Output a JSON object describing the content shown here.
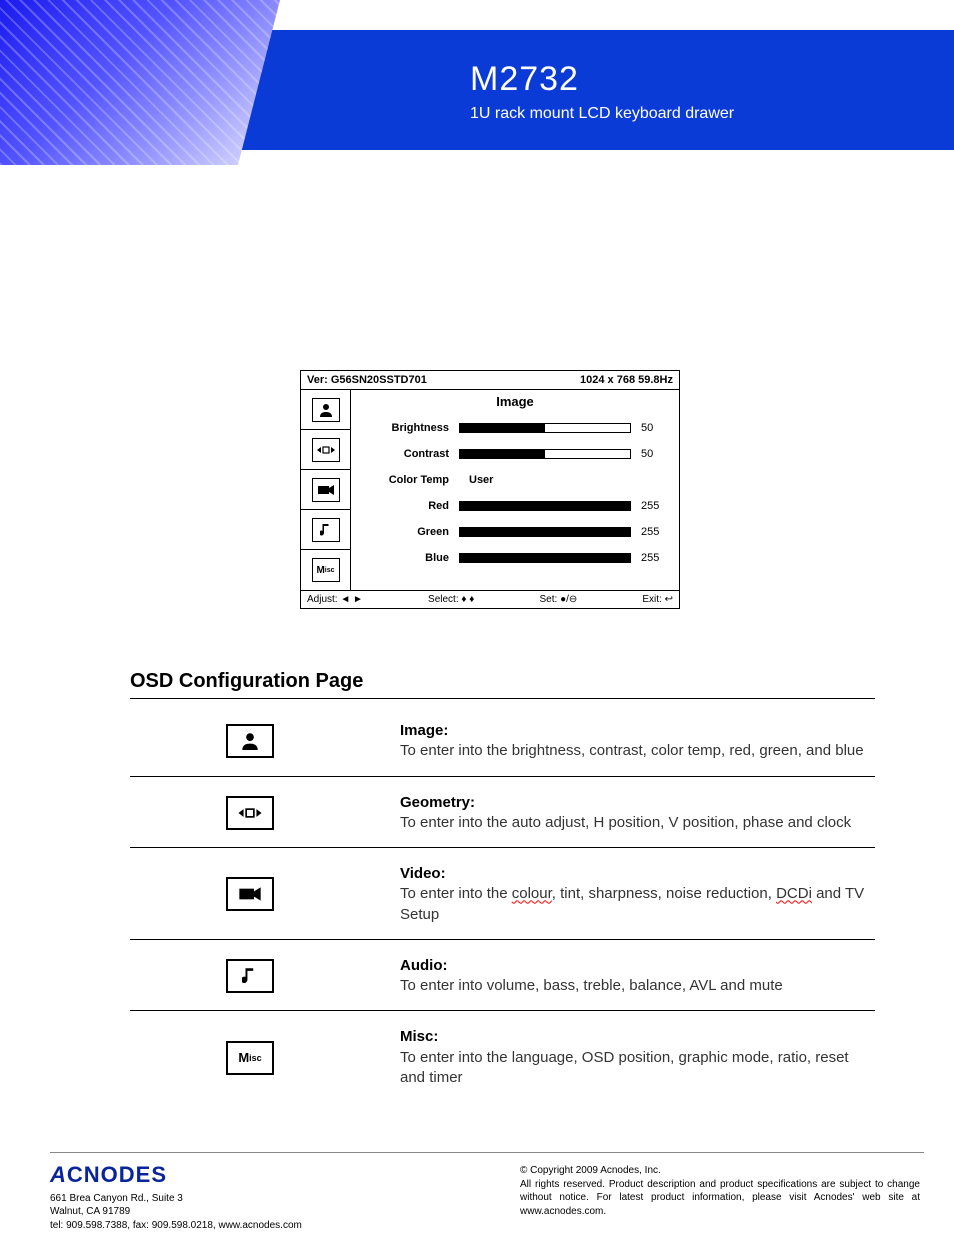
{
  "header": {
    "model": "M2732",
    "subtitle": "1U rack mount LCD keyboard drawer"
  },
  "osd": {
    "version_label": "Ver: G56SN20SSTD701",
    "resolution": "1024 x 768  59.8Hz",
    "title": "Image",
    "rows": {
      "brightness": {
        "label": "Brightness",
        "value": "50",
        "fill": 50
      },
      "contrast": {
        "label": "Contrast",
        "value": "50",
        "fill": 50
      },
      "colortemp": {
        "label": "Color Temp",
        "text": "User"
      },
      "red": {
        "label": "Red",
        "value": "255",
        "fill": 100
      },
      "green": {
        "label": "Green",
        "value": "255",
        "fill": 100
      },
      "blue": {
        "label": "Blue",
        "value": "255",
        "fill": 100
      }
    },
    "footer": {
      "adjust": "Adjust: ◄ ►",
      "select": "Select: ♦ ♦",
      "set": "Set: ●/⊖",
      "exit": "Exit: ↩"
    }
  },
  "section": {
    "title": "OSD Configuration Page"
  },
  "items": [
    {
      "icon": "image",
      "title": "Image:",
      "desc_pre": "To enter into the brightness, contrast, color temp, red, green, and blue"
    },
    {
      "icon": "geometry",
      "title": "Geometry:",
      "desc_pre": "To enter into the auto adjust, H position, V position, phase and clock"
    },
    {
      "icon": "video",
      "title": "Video:",
      "desc_pre": "To enter into the ",
      "sq1": "colour",
      "mid1": ", tint, sharpness, noise reduction, ",
      "sq2": "DCDi",
      "mid2": " and TV Setup"
    },
    {
      "icon": "audio",
      "title": "Audio:",
      "desc_pre": "To enter into volume, bass, treble, balance, AVL and mute"
    },
    {
      "icon": "misc",
      "title": "Misc:",
      "desc_pre": "To enter into the language, OSD position, graphic mode, ratio, reset and timer"
    }
  ],
  "footer": {
    "logo": "CNODES",
    "addr1": "661 Brea Canyon Rd., Suite 3",
    "addr2": "Walnut, CA 91789",
    "addr3": "tel: 909.598.7388, fax: 909.598.0218, www.acnodes.com",
    "copy": "© Copyright 2009 Acnodes, Inc.",
    "legal": "All rights reserved. Product description and product specifications are subject to change without notice. For latest product information, please visit Acnodes' web site at www.acnodes.com."
  }
}
